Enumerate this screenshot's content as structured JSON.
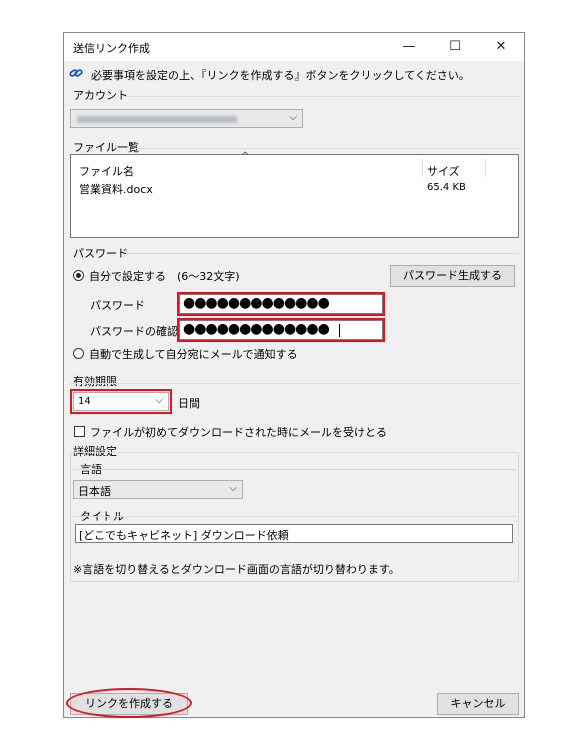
{
  "window": {
    "title": "送信リンク作成",
    "minimize": "—",
    "maximize": "☐",
    "close": "✕"
  },
  "info_message": "必要事項を設定の上、『リンクを作成する』ボタンをクリックしてください。",
  "account": {
    "label": "アカウント",
    "value": ""
  },
  "file_list": {
    "label": "ファイル一覧",
    "sort_indicator": "^",
    "columns": [
      "ファイル名",
      "サイズ"
    ],
    "rows": [
      {
        "name": "営業資料.docx",
        "size": "65.4 KB"
      }
    ]
  },
  "password": {
    "group_label": "パスワード",
    "manual_option": "自分で設定する",
    "manual_hint": "(6～32文字)",
    "generate_button": "パスワード生成する",
    "password_label": "パスワード",
    "password_value": "●●●●●●●●●●●●●",
    "confirm_label": "パスワードの確認",
    "confirm_value": "●●●●●●●●●●●●●",
    "auto_option": "自動で生成して自分宛にメールで通知する",
    "manual_selected": true
  },
  "expiry": {
    "label": "有効期限",
    "value": "14",
    "unit": "日間"
  },
  "notify_checkbox": {
    "label": "ファイルが初めてダウンロードされた時にメールを受けとる",
    "checked": false
  },
  "details": {
    "label": "詳細設定",
    "language_label": "言語",
    "language_value": "日本語",
    "title_label": "タイトル",
    "title_value": "[どこでもキャビネット] ダウンロード依頼",
    "note": "※言語を切り替えるとダウンロード画面の言語が切り替わります。"
  },
  "buttons": {
    "create": "リンクを作成する",
    "cancel": "キャンセル"
  },
  "colors": {
    "highlight": "#e0141e",
    "window_bg": "#f0f0f0",
    "link_icon": "#1e5bbd"
  }
}
